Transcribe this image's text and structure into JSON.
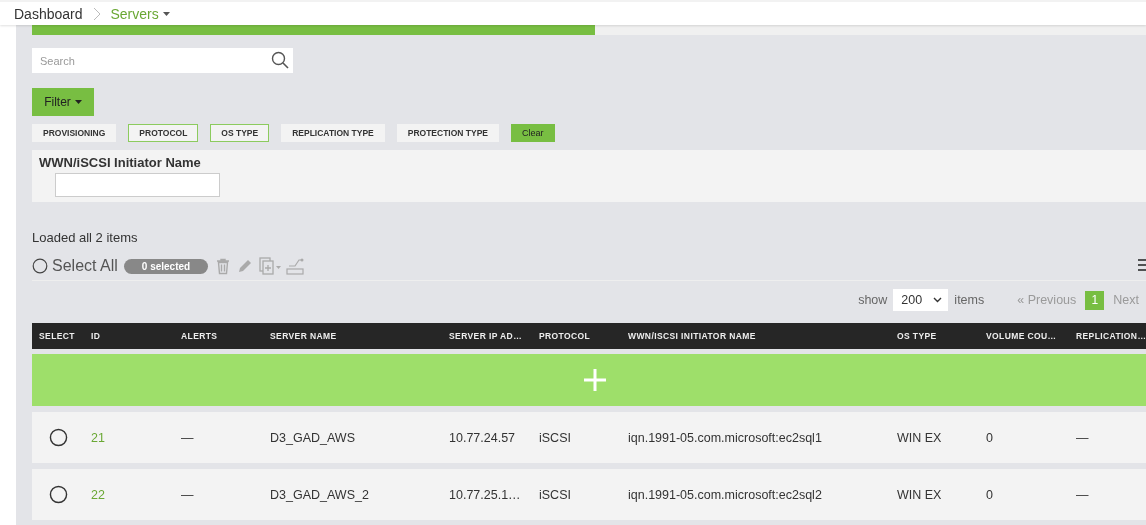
{
  "breadcrumb": {
    "items": [
      {
        "label": "Dashboard",
        "current": false
      },
      {
        "label": "Servers",
        "current": true
      }
    ]
  },
  "tabs": [
    {
      "selected": true
    },
    {
      "selected": false
    }
  ],
  "search": {
    "placeholder": "Search"
  },
  "filter_button": "Filter",
  "filter_chips": [
    {
      "label": "PROVISIONING",
      "selected": false
    },
    {
      "label": "PROTOCOL",
      "selected": true
    },
    {
      "label": "OS TYPE",
      "selected": true
    },
    {
      "label": "REPLICATION TYPE",
      "selected": false
    },
    {
      "label": "PROTECTION TYPE",
      "selected": false
    }
  ],
  "clear_button": "Clear",
  "filter_panel": {
    "label": "WWN/iSCSI Initiator Name"
  },
  "status": "Loaded all 2 items",
  "select_all": {
    "label": "Select All",
    "checked": false
  },
  "selected_count": "0 selected",
  "pagination": {
    "show_label": "show",
    "page_size": "200",
    "items_label": "items",
    "previous": {
      "label": "« Previous",
      "disabled": true
    },
    "pages": [
      {
        "label": "1",
        "selected": true
      }
    ],
    "next": {
      "label": "Next",
      "disabled": true
    }
  },
  "table": {
    "columns": [
      "SELECT",
      "ID",
      "ALERTS",
      "SERVER NAME",
      "SERVER IP AD…",
      "PROTOCOL",
      "WWN/ISCSI INITIATOR NAME",
      "OS TYPE",
      "VOLUME COU…",
      "REPLICATION…"
    ],
    "rows": [
      {
        "selected": false,
        "cells": [
          "",
          "21",
          "—",
          "D3_GAD_AWS",
          "10.77.24.57",
          "iSCSI",
          "iqn.1991-05.com.microsoft:ec2sql1",
          "WIN EX",
          "0",
          "—"
        ]
      },
      {
        "selected": false,
        "cells": [
          "",
          "22",
          "—",
          "D3_GAD_AWS_2",
          "10.77.25.1…",
          "iSCSI",
          "iqn.1991-05.com.microsoft:ec2sql2",
          "WIN EX",
          "0",
          "—"
        ]
      }
    ]
  }
}
